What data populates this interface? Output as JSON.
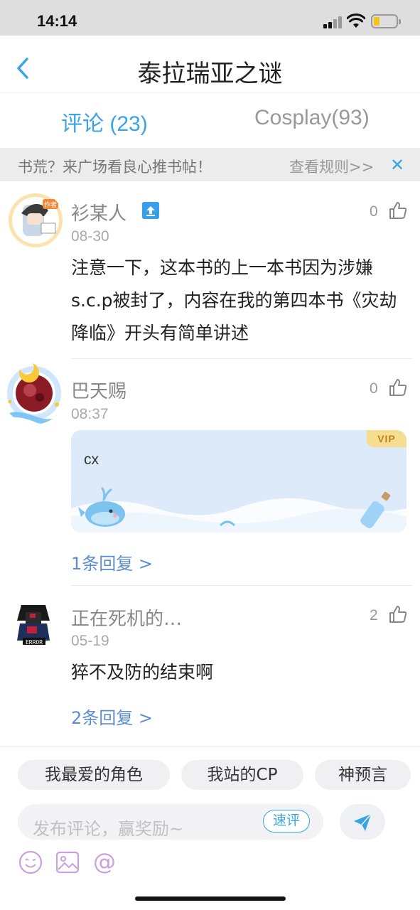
{
  "status_bar": {
    "time": "14:14"
  },
  "nav": {
    "title": "泰拉瑞亚之谜"
  },
  "tabs": [
    {
      "label": "评论 (23)",
      "active": true
    },
    {
      "label": "Cosplay(93)",
      "active": false
    }
  ],
  "banner": {
    "text": "书荒？来广场看良心推书帖！",
    "link": "查看规则>>",
    "close": "✕"
  },
  "comments": [
    {
      "name": "衫某人",
      "date": "08-30",
      "likes": "0",
      "avatar_badge": "作者",
      "text": "注意一下，这本书的上一本书因为涉嫌s.c.p被封了，内容在我的第四本书《灾劫降临》开头有简单讲述"
    },
    {
      "name": "巴天赐",
      "date": "08:37",
      "likes": "0",
      "vip_tag": "VIP",
      "text": "cx",
      "reply": "1条回复 >"
    },
    {
      "name": "正在死机的…",
      "date": "05-19",
      "likes": "2",
      "avatar_badge": "ERROR",
      "text": "猝不及防的结束啊",
      "reply": "2条回复 >"
    }
  ],
  "bottom": {
    "chips": [
      "我最爱的角色",
      "我站的CP",
      "神预言"
    ],
    "input_placeholder": "发布评论，赢奖励~",
    "quick_review": "速评"
  },
  "colors": {
    "accent": "#3aa3e3",
    "reply_link": "#5b8ed0"
  }
}
